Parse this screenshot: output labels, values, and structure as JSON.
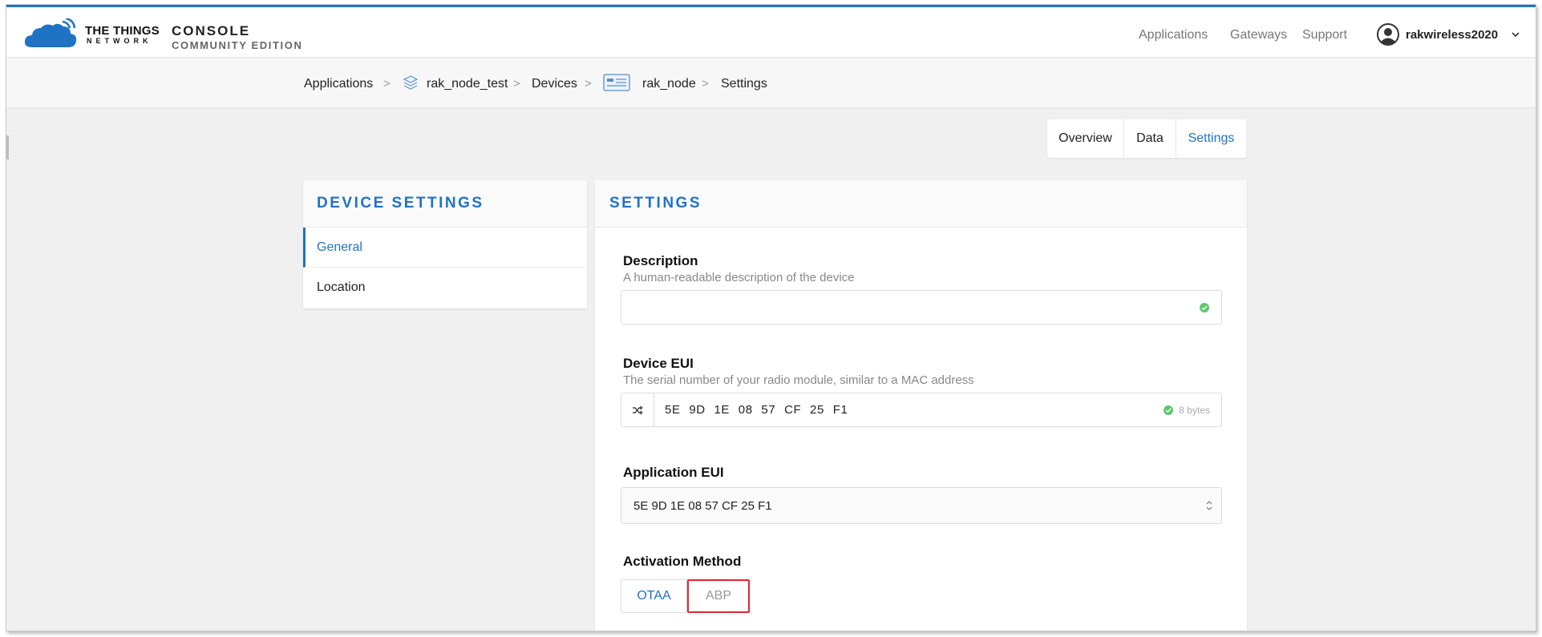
{
  "header": {
    "brand_line1": "THE THINGS",
    "brand_line2": "NETWORK",
    "console_line1": "CONSOLE",
    "console_line2": "COMMUNITY EDITION",
    "nav": [
      "Applications",
      "Gateways",
      "Support"
    ],
    "user": "rakwireless2020",
    "accent": "#1f73c4"
  },
  "breadcrumb": {
    "items": [
      "Applications",
      "rak_node_test",
      "Devices",
      "rak_node",
      "Settings"
    ],
    "separator": ">"
  },
  "tabs": {
    "items": [
      "Overview",
      "Data",
      "Settings"
    ],
    "active": "Settings"
  },
  "sidebar": {
    "title": "DEVICE SETTINGS",
    "items": [
      "General",
      "Location"
    ],
    "active": "General"
  },
  "settings": {
    "title": "SETTINGS",
    "description": {
      "label": "Description",
      "help": "A human-readable description of the device",
      "value": ""
    },
    "device_eui": {
      "label": "Device EUI",
      "help": "The serial number of your radio module, similar to a MAC address",
      "value": "5E 9D 1E 08 57 CF 25 F1",
      "bytes": "8 bytes"
    },
    "application_eui": {
      "label": "Application EUI",
      "value": "5E 9D 1E 08 57 CF 25 F1"
    },
    "activation": {
      "label": "Activation Method",
      "options": [
        "OTAA",
        "ABP"
      ],
      "highlight_color": "#e0262c"
    }
  }
}
